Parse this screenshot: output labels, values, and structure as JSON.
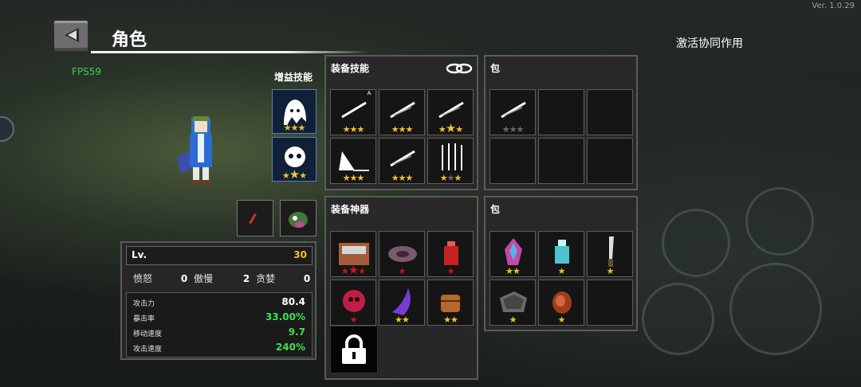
{
  "version": "Ver. 1.0.29",
  "header": {
    "title": "角色",
    "synergy_label": "激活协同作用"
  },
  "fps": "FPS59",
  "buff": {
    "label": "增益技能",
    "slots": [
      {
        "icon": "ghost-icon",
        "stars": [
          1,
          1,
          1
        ]
      },
      {
        "icon": "skull-bomb-icon",
        "stars": [
          1,
          2,
          1
        ]
      }
    ]
  },
  "skills_panel": {
    "title": "装备技能",
    "slots": [
      {
        "icon": "slash-arrow-icon",
        "stars": [
          "g",
          "g",
          "g"
        ]
      },
      {
        "icon": "slash-icon",
        "stars": [
          "g",
          "g",
          "g"
        ]
      },
      {
        "icon": "slash-icon",
        "stars": [
          "g",
          "G",
          "g"
        ]
      },
      {
        "icon": "wave-slash-icon",
        "stars": [
          "g",
          "g",
          "g"
        ]
      },
      {
        "icon": "slash-icon",
        "stars": [
          "g",
          "g",
          "g"
        ]
      },
      {
        "icon": "arrow-volley-icon",
        "stars": [
          "g",
          "x",
          "g"
        ]
      }
    ]
  },
  "skills_bag": {
    "title": "包",
    "slots": [
      {
        "icon": "slash-icon",
        "stars": [
          "x",
          "x",
          "x"
        ]
      }
    ],
    "total": 6
  },
  "artifacts_panel": {
    "title": "装备神器",
    "slots": [
      {
        "icon": "chest-icon",
        "stars": [
          "r",
          "R",
          "r"
        ]
      },
      {
        "icon": "plate-icon",
        "stars": [
          "r"
        ]
      },
      {
        "icon": "potion-icon",
        "stars": [
          "r"
        ]
      },
      {
        "icon": "skull-orb-icon",
        "stars": [
          "r"
        ]
      },
      {
        "icon": "purple-horn-icon",
        "stars": [
          "g",
          "g"
        ]
      },
      {
        "icon": "barrel-icon",
        "stars": [
          "g",
          "g"
        ]
      }
    ]
  },
  "artifacts_bag": {
    "title": "包",
    "slots": [
      {
        "icon": "crystal-icon",
        "stars": [
          "g",
          "g"
        ]
      },
      {
        "icon": "bottle-icon",
        "stars": [
          "g"
        ]
      },
      {
        "icon": "knife-icon",
        "stars": [
          "g"
        ]
      },
      {
        "icon": "stone-icon",
        "stars": [
          "g"
        ]
      },
      {
        "icon": "meat-icon",
        "stars": [
          "g"
        ]
      }
    ],
    "total": 6
  },
  "stats": {
    "lv_label": "Lv.",
    "lv_value": "30",
    "sins": [
      {
        "label": "愤怒",
        "value": "0"
      },
      {
        "label": "傲慢",
        "value": "2"
      },
      {
        "label": "贪婪",
        "value": "0"
      }
    ],
    "attributes": [
      {
        "label": "攻击力",
        "value": "80.4",
        "color": "#ffffff"
      },
      {
        "label": "暴击率",
        "value": "33.00%",
        "color": "#3ee04a"
      },
      {
        "label": "移动速度",
        "value": "9.7",
        "color": "#3ee04a"
      },
      {
        "label": "攻击速度",
        "value": "240%",
        "color": "#3ee04a"
      }
    ]
  },
  "colors": {
    "star_gold": "#f2c230",
    "star_grey": "#6a6a6a",
    "star_red": "#c4181c",
    "fps": "#3fcf52"
  }
}
